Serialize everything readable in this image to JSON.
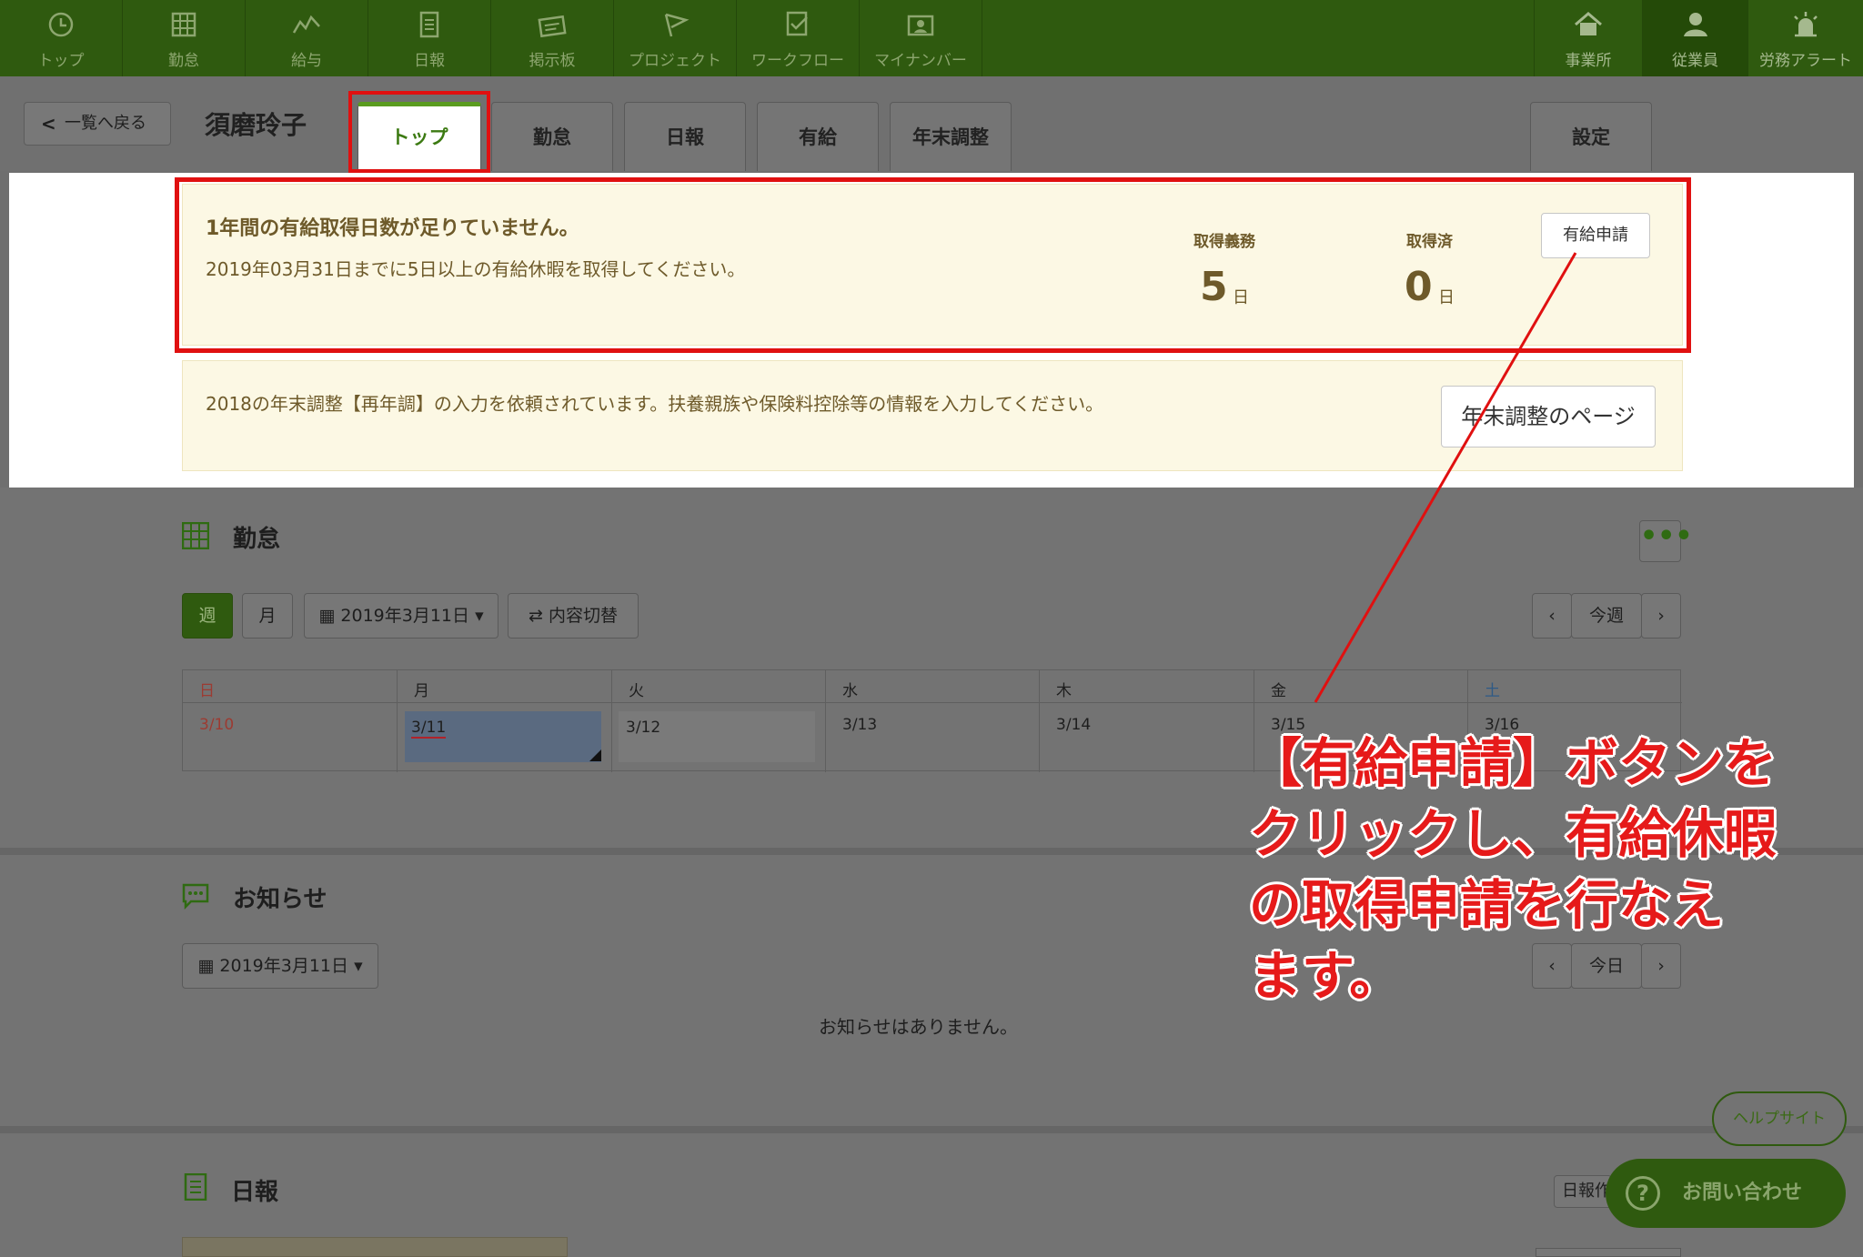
{
  "nav": {
    "items": [
      {
        "label": "トップ",
        "icon": "clock-icon"
      },
      {
        "label": "勤怠",
        "icon": "grid-icon"
      },
      {
        "label": "給与",
        "icon": "chart-icon"
      },
      {
        "label": "日報",
        "icon": "document-icon"
      },
      {
        "label": "掲示板",
        "icon": "board-icon"
      },
      {
        "label": "プロジェクト",
        "icon": "flag-icon"
      },
      {
        "label": "ワークフロー",
        "icon": "checklist-icon"
      },
      {
        "label": "マイナンバー",
        "icon": "id-card-icon"
      }
    ],
    "right_items": [
      {
        "label": "事業所",
        "icon": "home-icon"
      },
      {
        "label": "従業員",
        "icon": "person-icon"
      },
      {
        "label": "労務アラート",
        "icon": "alarm-icon"
      }
    ]
  },
  "header": {
    "back_label": "一覧へ戻る",
    "employee_name": "須磨玲子",
    "tabs": [
      "トップ",
      "勤怠",
      "日報",
      "有給",
      "年末調整"
    ],
    "settings_tab": "設定"
  },
  "paid_leave_notice": {
    "title": "1年間の有給取得日数が足りていません。",
    "text": "2019年03月31日までに5日以上の有給休暇を取得してください。",
    "required_label": "取得義務",
    "required_value": "5",
    "taken_label": "取得済",
    "taken_value": "0",
    "unit": "日",
    "button_label": "有給申請"
  },
  "year_end_notice": {
    "text": "2018の年末調整【再年調】の入力を依頼されています。扶養親族や保険料控除等の情報を入力してください。",
    "button_label": "年末調整のページ"
  },
  "attendance": {
    "title": "勤怠",
    "more_label": "•••",
    "week_label": "週",
    "month_label": "月",
    "date_label": "2019年3月11日",
    "switch_label": "内容切替",
    "prev_label": "‹",
    "current_label": "今週",
    "next_label": "›",
    "days": [
      "日",
      "月",
      "火",
      "水",
      "木",
      "金",
      "土"
    ],
    "dates": [
      "3/10",
      "3/11",
      "3/12",
      "3/13",
      "3/14",
      "3/15",
      "3/16"
    ],
    "sun_color": "#c0392b",
    "sat_color": "#2c6aa0"
  },
  "news": {
    "title": "お知らせ",
    "date_label": "2019年3月11日",
    "prev_label": "‹",
    "current_label": "今日",
    "next_label": "›",
    "empty_text": "お知らせはありません。"
  },
  "report": {
    "title": "日報",
    "button_label": "日報作成"
  },
  "help": {
    "help_label": "ヘルプサイト",
    "contact_label": "お問い合わせ"
  },
  "annotation": {
    "lines": [
      "【有給申請】ボタンを",
      "クリックし、有給休暇",
      "の取得申請を行なえ",
      "ます。"
    ],
    "color": "#e61a1a"
  }
}
